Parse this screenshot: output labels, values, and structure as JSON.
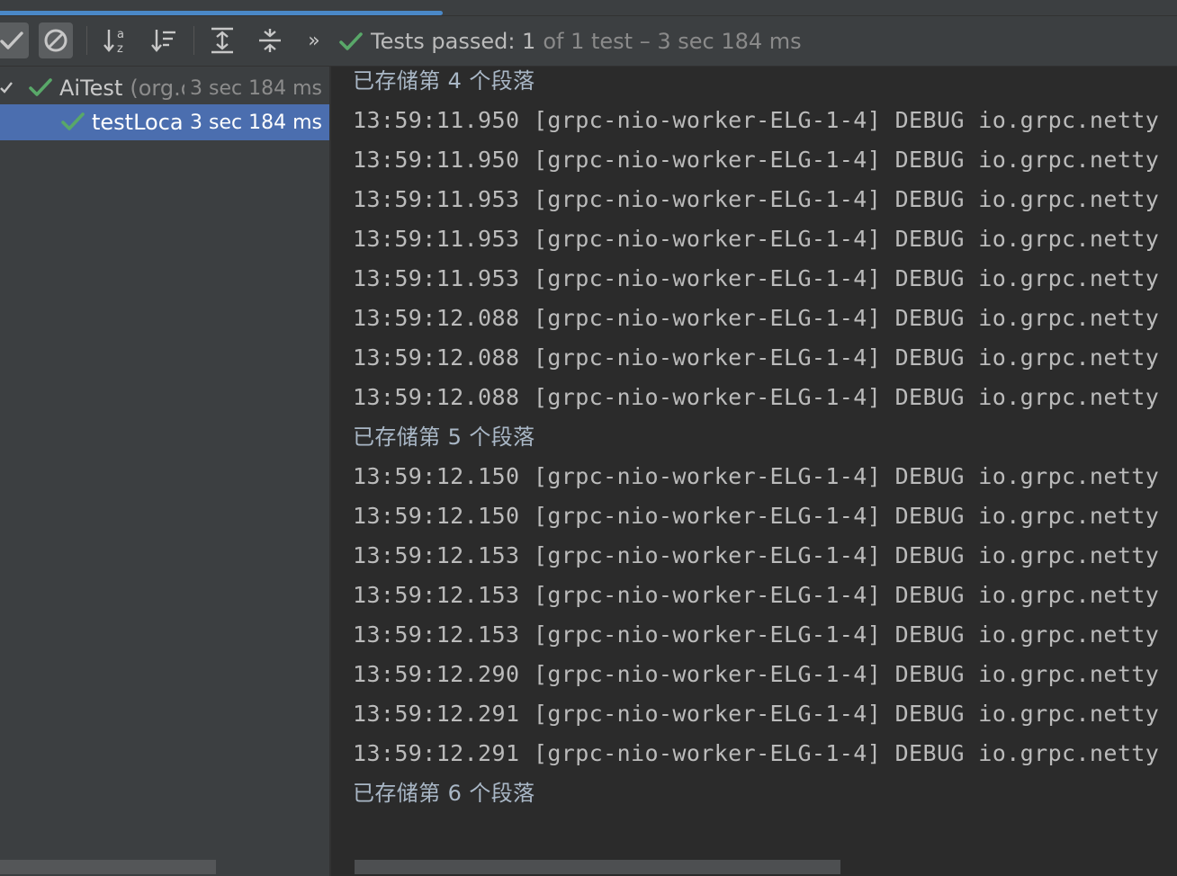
{
  "toolbar": {
    "buttons": [
      {
        "name": "show-passed",
        "icon": "check-icon"
      },
      {
        "name": "show-ignored",
        "icon": "prohibit-icon"
      },
      {
        "name": "sort-alphabetically",
        "icon": "sort-alpha-icon"
      },
      {
        "name": "sort-by-duration",
        "icon": "sort-duration-icon"
      },
      {
        "name": "expand-all",
        "icon": "expand-all-icon"
      },
      {
        "name": "collapse-all",
        "icon": "collapse-all-icon"
      },
      {
        "name": "more",
        "icon": "chevrons-right-icon"
      }
    ],
    "more_glyph": "»",
    "status_passed": "Tests passed: 1",
    "status_rest": "of 1 test – 3 sec 184 ms"
  },
  "tree": {
    "class": {
      "name": "AiTest",
      "package": "(org.dr",
      "time": "3 sec 184 ms"
    },
    "method": {
      "name": "testLocalEr",
      "time": "3 sec 184 ms"
    }
  },
  "console": {
    "lines": [
      "已存储第 4 个段落",
      "13:59:11.950 [grpc-nio-worker-ELG-1-4] DEBUG io.grpc.netty",
      "13:59:11.950 [grpc-nio-worker-ELG-1-4] DEBUG io.grpc.netty",
      "13:59:11.953 [grpc-nio-worker-ELG-1-4] DEBUG io.grpc.netty",
      "13:59:11.953 [grpc-nio-worker-ELG-1-4] DEBUG io.grpc.netty",
      "13:59:11.953 [grpc-nio-worker-ELG-1-4] DEBUG io.grpc.netty",
      "13:59:12.088 [grpc-nio-worker-ELG-1-4] DEBUG io.grpc.netty",
      "13:59:12.088 [grpc-nio-worker-ELG-1-4] DEBUG io.grpc.netty",
      "13:59:12.088 [grpc-nio-worker-ELG-1-4] DEBUG io.grpc.netty",
      "已存储第 5 个段落",
      "13:59:12.150 [grpc-nio-worker-ELG-1-4] DEBUG io.grpc.netty",
      "13:59:12.150 [grpc-nio-worker-ELG-1-4] DEBUG io.grpc.netty",
      "13:59:12.153 [grpc-nio-worker-ELG-1-4] DEBUG io.grpc.netty",
      "13:59:12.153 [grpc-nio-worker-ELG-1-4] DEBUG io.grpc.netty",
      "13:59:12.153 [grpc-nio-worker-ELG-1-4] DEBUG io.grpc.netty",
      "13:59:12.290 [grpc-nio-worker-ELG-1-4] DEBUG io.grpc.netty",
      "13:59:12.291 [grpc-nio-worker-ELG-1-4] DEBUG io.grpc.netty",
      "13:59:12.291 [grpc-nio-worker-ELG-1-4] DEBUG io.grpc.netty",
      "已存储第 6 个段落"
    ]
  },
  "colors": {
    "panel": "#3c3f41",
    "console_bg": "#2b2b2b",
    "selection": "#4b6eaf",
    "success_green": "#59a869",
    "tab_accent": "#4a88c7"
  }
}
